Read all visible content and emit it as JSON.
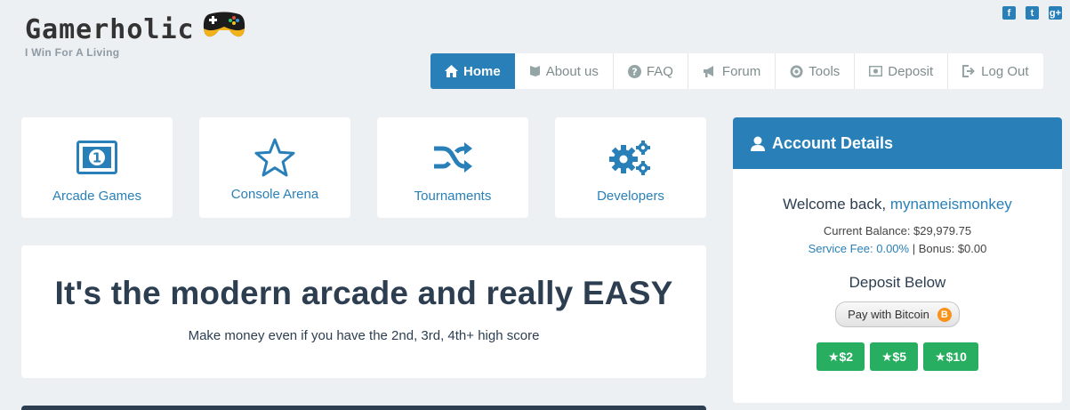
{
  "brand": {
    "title": "Gamerholic",
    "tagline": "I Win For A Living"
  },
  "social": {
    "facebook": "f",
    "twitter": "t",
    "googleplus": "g+"
  },
  "nav": {
    "home": "Home",
    "about": "About us",
    "faq": "FAQ",
    "forum": "Forum",
    "tools": "Tools",
    "deposit": "Deposit",
    "logout": "Log Out"
  },
  "tiles": {
    "arcade": "Arcade Games",
    "console": "Console Arena",
    "tournaments": "Tournaments",
    "developers": "Developers"
  },
  "hero": {
    "headline": "It's the modern arcade and really EASY",
    "subline": "Make money even if you have the 2nd, 3rd, 4th+ high score"
  },
  "account": {
    "title": "Account Details",
    "welcome_prefix": "Welcome back,",
    "username": "mynameismonkey",
    "balance": "Current Balance: $29,979.75",
    "service_fee": "Service Fee: 0.00%",
    "separator": "|",
    "bonus": "Bonus: $0.00",
    "deposit_title": "Deposit Below",
    "pay_button": "Pay with Bitcoin",
    "coin_symbol": "B",
    "amounts": [
      "★$2",
      "★$5",
      "★$10"
    ]
  },
  "colors": {
    "primary": "#2980b9",
    "success": "#27ae60",
    "dark": "#2c3e50",
    "background": "#edf0f2",
    "bitcoin": "#f7931a"
  }
}
